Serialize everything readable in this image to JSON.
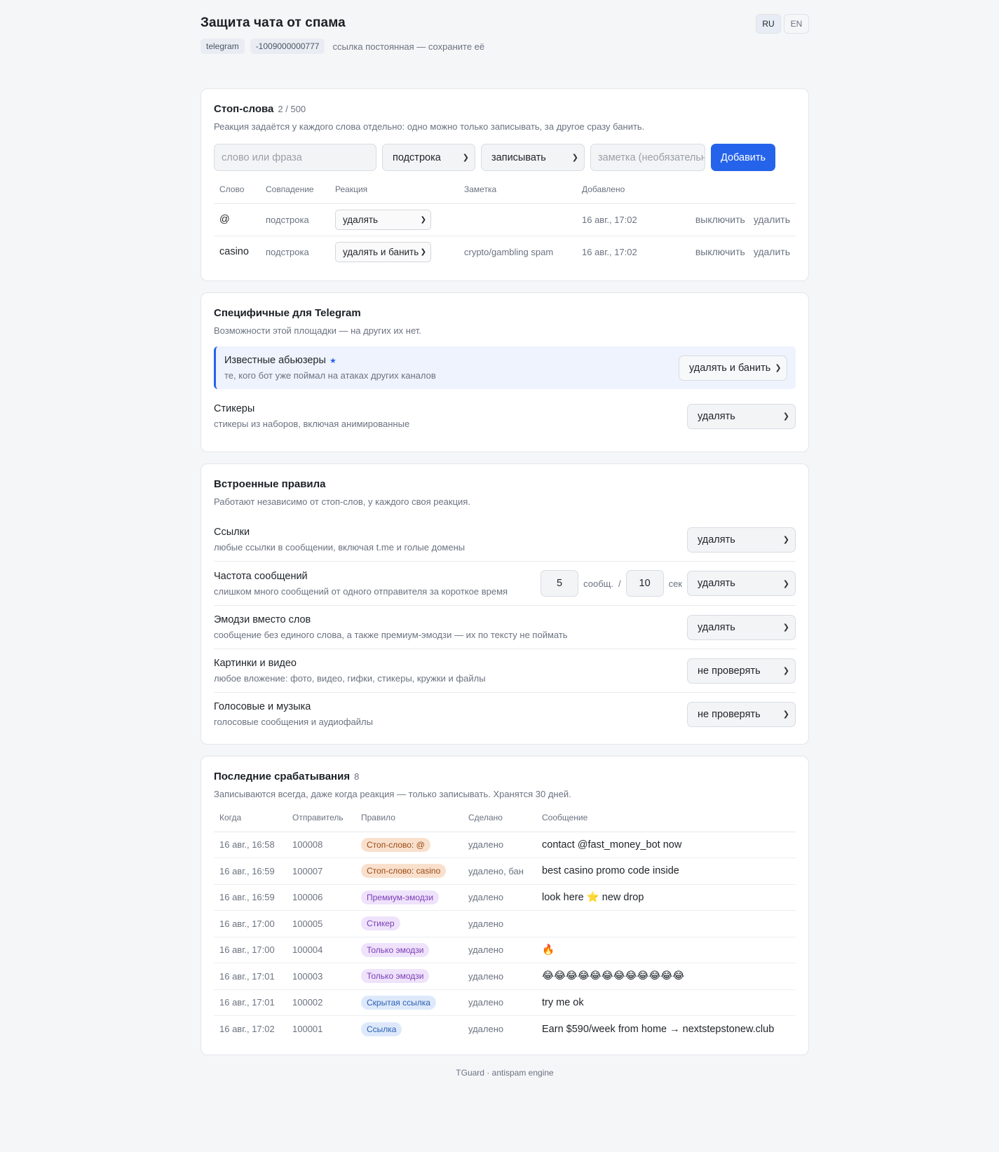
{
  "header": {
    "title": "Защита чата от спама",
    "platform": "telegram",
    "chat_id": "-1009000000777",
    "note": "ссылка постоянная — сохраните её",
    "lang": [
      "RU",
      "EN"
    ]
  },
  "stopwords": {
    "title": "Стоп-слова",
    "count": "2 / 500",
    "desc": "Реакция задаётся у каждого слова отдельно: одно можно только записывать, за другое сразу банить.",
    "input_placeholder": "слово или фраза",
    "match_select": "подстрока",
    "reaction_select": "записывать",
    "note_placeholder": "заметка (необязательно)",
    "add_label": "Добавить",
    "columns": [
      "Слово",
      "Совпадение",
      "Реакция",
      "Заметка",
      "Добавлено",
      ""
    ],
    "rows": [
      {
        "word": "@",
        "match": "подстрока",
        "reaction": "удалять",
        "note": "",
        "added": "16 авг., 17:02",
        "toggle": "выключить",
        "delete": "удалить"
      },
      {
        "word": "casino",
        "match": "подстрока",
        "reaction": "удалять и банить",
        "note": "crypto/gambling spam",
        "added": "16 авг., 17:02",
        "toggle": "выключить",
        "delete": "удалить"
      }
    ]
  },
  "telegram": {
    "title": "Специфичные для Telegram",
    "desc": "Возможности этой площадки — на других их нет.",
    "abusers": {
      "name": "Известные абьюзеры",
      "star": "★",
      "desc": "те, кого бот уже поймал на атаках других каналов",
      "value": "удалять и банить"
    },
    "stickers": {
      "name": "Стикеры",
      "desc": "стикеры из наборов, включая анимированные",
      "value": "удалять"
    }
  },
  "rules": {
    "title": "Встроенные правила",
    "desc": "Работают независимо от стоп-слов, у каждого своя реакция.",
    "links": {
      "name": "Ссылки",
      "desc": "любые ссылки в сообщении, включая t.me и голые домены",
      "value": "удалять"
    },
    "rate": {
      "name": "Частота сообщений",
      "desc": "слишком много сообщений от одного отправителя за короткое время",
      "count": "5",
      "count_unit": "сообщ.",
      "slash": "/",
      "seconds": "10",
      "seconds_unit": "сек",
      "value": "удалять"
    },
    "emoji": {
      "name": "Эмодзи вместо слов",
      "desc": "сообщение без единого слова, а также премиум-эмодзи — их по тексту не поймать",
      "value": "удалять"
    },
    "media": {
      "name": "Картинки и видео",
      "desc": "любое вложение: фото, видео, гифки, стикеры, кружки и файлы",
      "value": "не проверять"
    },
    "voice": {
      "name": "Голосовые и музыка",
      "desc": "голосовые сообщения и аудиофайлы",
      "value": "не проверять"
    }
  },
  "log": {
    "title": "Последние срабатывания",
    "count": "8",
    "desc": "Записываются всегда, даже когда реакция — только записывать. Хранятся 30 дней.",
    "columns": [
      "Когда",
      "Отправитель",
      "Правило",
      "Сделано",
      "Сообщение"
    ],
    "rows": [
      {
        "when": "16 авг., 16:58",
        "sender": "100008",
        "rule": "Стоп-слово: @",
        "kind": "stop",
        "done": "удалено",
        "message": "contact @fast_money_bot now"
      },
      {
        "when": "16 авг., 16:59",
        "sender": "100007",
        "rule": "Стоп-слово: casino",
        "kind": "stop",
        "done": "удалено, бан",
        "message": "best casino promo code inside"
      },
      {
        "when": "16 авг., 16:59",
        "sender": "100006",
        "rule": "Премиум-эмодзи",
        "kind": "purple",
        "done": "удалено",
        "message": "look here ⭐ new drop"
      },
      {
        "when": "16 авг., 17:00",
        "sender": "100005",
        "rule": "Стикер",
        "kind": "purple",
        "done": "удалено",
        "message": ""
      },
      {
        "when": "16 авг., 17:00",
        "sender": "100004",
        "rule": "Только эмодзи",
        "kind": "purple",
        "done": "удалено",
        "message": "🔥"
      },
      {
        "when": "16 авг., 17:01",
        "sender": "100003",
        "rule": "Только эмодзи",
        "kind": "purple",
        "done": "удалено",
        "message": "😂😂😂😂😂😂😂😂😂😂😂😂"
      },
      {
        "when": "16 авг., 17:01",
        "sender": "100002",
        "rule": "Скрытая ссылка",
        "kind": "blue",
        "done": "удалено",
        "message": "try me ok"
      },
      {
        "when": "16 авг., 17:02",
        "sender": "100001",
        "rule": "Ссылка",
        "kind": "blue",
        "done": "удалено",
        "message": "Earn $590/week from home → nextstepstonew.club"
      }
    ]
  },
  "footer": "TGuard · antispam engine",
  "colors": {
    "accent": "#2563eb",
    "page_bg": "#f5f6f8"
  }
}
